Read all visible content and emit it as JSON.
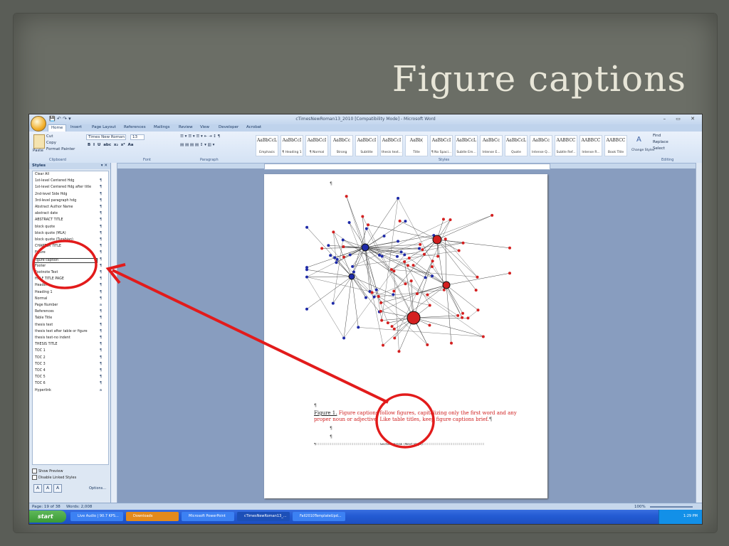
{
  "slide": {
    "title": "Figure captions"
  },
  "window": {
    "title": "cTimesNewRoman13_2010 [Compatibility Mode] - Microsoft Word",
    "controls": "– ▭ ✕"
  },
  "tabs": [
    "Home",
    "Insert",
    "Page Layout",
    "References",
    "Mailings",
    "Review",
    "View",
    "Developer",
    "Acrobat"
  ],
  "ribbon": {
    "clipboard": {
      "paste": "Paste",
      "cut": "Cut",
      "copy": "Copy",
      "format_painter": "Format Painter",
      "group": "Clipboard"
    },
    "font": {
      "name": "Times New Roman",
      "size": "13",
      "group": "Font"
    },
    "paragraph": {
      "group": "Paragraph"
    },
    "styles_group": "Styles",
    "quick_styles": [
      {
        "preview": "AaBbCcL",
        "name": "Emphasis"
      },
      {
        "preview": "AaBbCcI",
        "name": "¶ Heading 1"
      },
      {
        "preview": "AaBbCcI",
        "name": "¶ Normal"
      },
      {
        "preview": "AaBbCc",
        "name": "Strong"
      },
      {
        "preview": "AaBbCcI",
        "name": "Subtitle"
      },
      {
        "preview": "AaBbCcI",
        "name": "thesis text..."
      },
      {
        "preview": "AaBb(",
        "name": "Title"
      },
      {
        "preview": "AaBbCcI",
        "name": "¶ No Spaci..."
      },
      {
        "preview": "AaBbCcL",
        "name": "Subtle Em..."
      },
      {
        "preview": "AaBbCc",
        "name": "Intense E..."
      },
      {
        "preview": "AaBbCcL",
        "name": "Quote"
      },
      {
        "preview": "AaBbCc",
        "name": "Intense Q..."
      },
      {
        "preview": "AABBCC",
        "name": "Subtle Ref..."
      },
      {
        "preview": "AABBCC",
        "name": "Intense R..."
      },
      {
        "preview": "AABBCC",
        "name": "Book Title"
      }
    ],
    "change_styles": "Change Styles",
    "editing": {
      "find": "Find",
      "replace": "Replace",
      "select": "Select",
      "group": "Editing"
    }
  },
  "styles_pane": {
    "title": "Styles",
    "items": [
      "Clear All",
      "1st-level Centered Hdg",
      "1st-level Centered Hdg after title",
      "2nd-level Side Hdg",
      "3rd-level paragraph hdg",
      "Abstract Author Name",
      "abstract date",
      "ABSTRACT TITLE",
      "block quote",
      "block quote (MLA)",
      "block quote (Turabian)",
      "CHAPTER TITLE",
      "Figure",
      "Figure caption",
      "Footer",
      "Footnote Text",
      "HALF TITLE PAGE",
      "Header",
      "Heading 1",
      "Normal",
      "Page Number",
      "References",
      "Table Title",
      "thesis text",
      "thesis text after table or figure",
      "thesis text-no indent",
      "THESIS TITLE",
      "TOC 1",
      "TOC 2",
      "TOC 3",
      "TOC 4",
      "TOC 5",
      "TOC 6",
      "Hyperlink"
    ],
    "selected": "Figure caption",
    "show_preview": "Show Preview",
    "disable_linked": "Disable Linked Styles",
    "options": "Options..."
  },
  "document": {
    "caption_label": "Figure 1.",
    "caption_text": " Figure captions follow figures, capitalizing only the first word and any proper noun or adjective. Like table titles, keep figure captions brief.",
    "section_break": "Section Break (Next Page)"
  },
  "status": {
    "page": "Page: 19 of 38",
    "words": "Words: 2,008",
    "zoom": "100%"
  },
  "taskbar": {
    "start": "start",
    "tasks": [
      "Live Audio | 90.7 KPS...",
      "Downloads",
      "Microsoft PowerPoint",
      "cTimesNewRoman13_...",
      "Fall2010TemplateUpd..."
    ],
    "time": "1:29 PM"
  },
  "colors": {
    "accent": "#e02020",
    "node_red": "#d42020",
    "node_blue": "#1e2aa8",
    "slide_bg": "#6b6e66"
  }
}
